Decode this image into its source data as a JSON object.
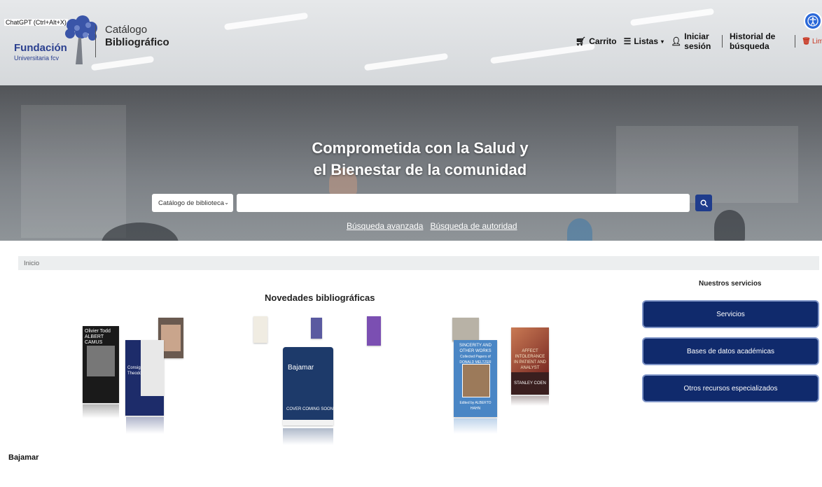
{
  "overlay": {
    "chatgpt_hint": "ChatGPT (Ctrl+Alt+X)"
  },
  "logo": {
    "name": "Fundación",
    "sub": "Universitaria fcv",
    "catalog_line1": "Catálogo",
    "catalog_line2": "Bibliográfico"
  },
  "nav": {
    "cart": "Carrito",
    "lists": "Listas",
    "login": "Iniciar sesión",
    "history": "Historial de búsqueda",
    "clear": "Limpiar"
  },
  "hero": {
    "slogan_line1": "Comprometida con la Salud y",
    "slogan_line2": "el Bienestar de la comunidad"
  },
  "search": {
    "scope": "Catálogo de biblioteca",
    "query": "",
    "advanced": "Búsqueda avanzada",
    "authority": "Búsqueda de autoridad"
  },
  "breadcrumb": {
    "home": "Inicio"
  },
  "novedades": {
    "title": "Novedades bibliográficas",
    "books": [
      {
        "title": "Olivier Todd ALBERT CAMUS"
      },
      {
        "title": "Consignas Theodor Adorno"
      },
      {
        "title": "Bajamar"
      },
      {
        "title": "COVER COMING SOON"
      },
      {
        "title": "SINCERITY AND OTHER WORKS"
      },
      {
        "title": "Collected Papers of DONALD MELTZER"
      },
      {
        "title": "Edited by ALBERTO HAHN"
      },
      {
        "title": "AFFECT INTOLERANCE IN PATIENT AND ANALYST"
      },
      {
        "title": "STANLEY COEN"
      }
    ]
  },
  "services": {
    "title": "Nuestros servicios",
    "items": [
      "Servicios",
      "Bases de datos académicas",
      "Otros recursos especializados"
    ]
  },
  "featured": {
    "title": "Bajamar"
  },
  "colors": {
    "primary": "#102a6c",
    "accent": "#2a68d8",
    "danger": "#c8341f"
  }
}
